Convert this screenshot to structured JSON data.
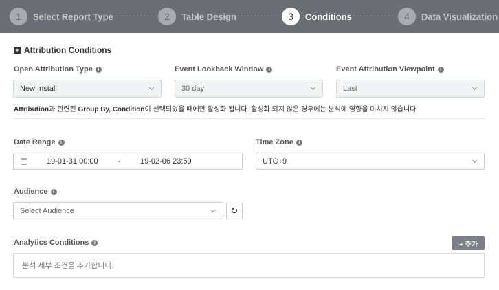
{
  "stepper": {
    "steps": [
      {
        "num": "1",
        "label": "Select Report Type"
      },
      {
        "num": "2",
        "label": "Table Design"
      },
      {
        "num": "3",
        "label": "Conditions"
      },
      {
        "num": "4",
        "label": "Data Visualization"
      }
    ],
    "active_index": 3
  },
  "attribution": {
    "section_title": "Attribution Conditions",
    "open_type": {
      "label": "Open Attribution Type",
      "value": "New Install"
    },
    "lookback": {
      "label": "Event Lookback Window",
      "value": "30 day"
    },
    "viewpoint": {
      "label": "Event Attribution Viewpoint",
      "value": "Last"
    },
    "note_prefix": "Attribution",
    "note_mid1": "과 관련된 ",
    "note_bold": "Group By, Condition",
    "note_rest": "이 선택되었을 때에만 활성화 됩니다. 활성화 되지 않은 경우에는 분석에 영향을 미치지 않습니다."
  },
  "date_range": {
    "label": "Date Range",
    "from": "19-01-31 00:00",
    "separator": "-",
    "to": "19-02-06 23:59"
  },
  "time_zone": {
    "label": "Time Zone",
    "value": "UTC+9"
  },
  "audience": {
    "label": "Audience",
    "placeholder": "Select Audience"
  },
  "analytics": {
    "label": "Analytics Conditions",
    "add_button": "+ 추가",
    "placeholder": "분석 세부 조건을 추가합니다."
  },
  "colors": {
    "header_bg": "#6b6f75",
    "active_step": "#ffffff",
    "button_bg": "#7c8086"
  }
}
